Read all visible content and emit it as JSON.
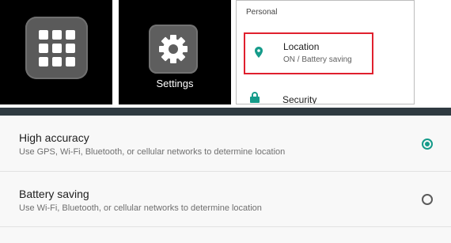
{
  "settings_app": {
    "label": "Settings"
  },
  "personal": {
    "header": "Personal",
    "location": {
      "title": "Location",
      "status": "ON / Battery saving"
    },
    "security": {
      "title": "Security"
    }
  },
  "location_mode": {
    "options": [
      {
        "title": "High accuracy",
        "description": "Use GPS, Wi-Fi, Bluetooth, or cellular networks to determine location",
        "selected": true
      },
      {
        "title": "Battery saving",
        "description": "Use Wi-Fi, Bluetooth, or cellular networks to determine location",
        "selected": false
      }
    ]
  },
  "colors": {
    "accent": "#159b8a",
    "highlight": "#e0202e",
    "top_bar": "#2f3a41"
  },
  "icons": [
    "apps-grid-icon",
    "settings-gear-icon",
    "location-pin-icon",
    "lock-icon",
    "radio-button-icon"
  ]
}
